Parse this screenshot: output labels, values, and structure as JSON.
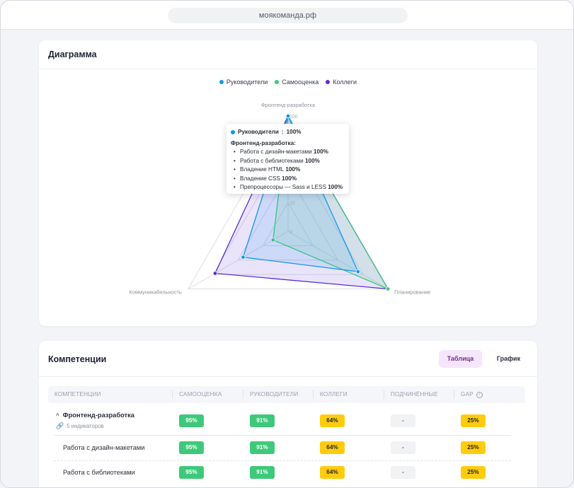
{
  "browser": {
    "url": "моякоманда.рф"
  },
  "diagram": {
    "title": "Диаграмма",
    "legend": [
      {
        "label": "Руководители",
        "color": "#1296f0"
      },
      {
        "label": "Самооценка",
        "color": "#3ec97a"
      },
      {
        "label": "Коллеги",
        "color": "#5b2ed6"
      }
    ],
    "tooltip": {
      "series": "Руководители",
      "value": "100%",
      "category": "Фронтенд-разработка:",
      "items": [
        {
          "label": "Работа с дизайн-макетами",
          "value": "100%"
        },
        {
          "label": "Работа с библиотеками",
          "value": "100%"
        },
        {
          "label": "Владение HTML",
          "value": "100%"
        },
        {
          "label": "Владение CSS",
          "value": "100%"
        },
        {
          "label": "Препроцессоры — Sass и LESS",
          "value": "100%"
        }
      ]
    }
  },
  "chart_data": {
    "type": "radar",
    "axes": [
      "Фронтенд-разработка",
      "Планирование",
      "Коммуникабельность"
    ],
    "ticks": [
      "0",
      "25",
      "100"
    ],
    "rlim": [
      0,
      100
    ],
    "series": [
      {
        "name": "Руководители",
        "color": "#1296f0",
        "values": [
          100,
          70,
          45
        ]
      },
      {
        "name": "Самооценка",
        "color": "#3ec97a",
        "values": [
          100,
          100,
          15
        ]
      },
      {
        "name": "Коллеги",
        "color": "#5b2ed6",
        "values": [
          100,
          100,
          73
        ]
      }
    ]
  },
  "competencies": {
    "title": "Компетенции",
    "tabs": {
      "table": "Таблица",
      "chart": "График"
    },
    "headers": [
      "КОМПЕТЕНЦИИ",
      "САМООЦЕНКА",
      "РУКОВОДИТЕЛИ",
      "КОЛЛЕГИ",
      "ПОДЧИНЁННЫЕ",
      "GAP"
    ],
    "group": {
      "name": "Фронтенд-разработка",
      "sub": "5 индикаторов",
      "cells": [
        "95%",
        "91%",
        "64%",
        "-",
        "25%"
      ]
    },
    "rows": [
      {
        "name": "Работа с дизайн-макетами",
        "cells": [
          "95%",
          "91%",
          "64%",
          "-",
          "25%"
        ]
      },
      {
        "name": "Работа с библиотеками",
        "cells": [
          "95%",
          "91%",
          "64%",
          "-",
          "25%"
        ]
      }
    ]
  }
}
